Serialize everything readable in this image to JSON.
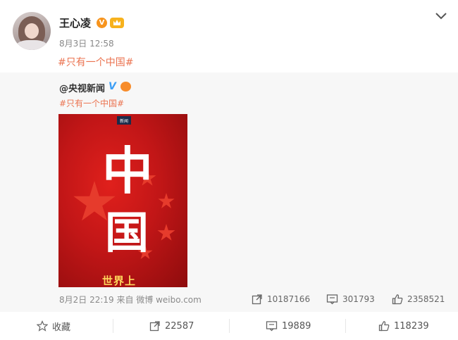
{
  "post": {
    "username": "王心凌",
    "timestamp": "8月3日 12:58",
    "hashtag": "#只有一个中国#"
  },
  "repost": {
    "author": "@央视新闻",
    "verified_mark": "V",
    "hashtag": "#只有一个中国#",
    "media": {
      "logo_text": "新闻",
      "char_1": "中",
      "char_2": "国",
      "subtitle": "世界上"
    },
    "meta": "8月2日 22:19 来自 微博 weibo.com",
    "stats": {
      "reposts": "10187166",
      "comments": "301793",
      "likes": "2358521"
    }
  },
  "actions": {
    "favorite_label": "收藏",
    "repost_count": "22587",
    "comment_count": "19889",
    "like_count": "118239"
  },
  "colors": {
    "link": "#eb7350",
    "verified_blue": "#3d9ef5",
    "badge_orange": "#f7941d"
  },
  "icons": [
    "chevron-down-icon",
    "share-icon",
    "comment-icon",
    "thumbs-up-icon",
    "star-icon"
  ]
}
